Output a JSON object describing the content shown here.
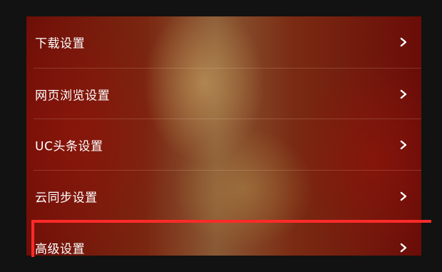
{
  "settings_list": {
    "items": [
      {
        "label": "下载设置"
      },
      {
        "label": "网页浏览设置"
      },
      {
        "label": "UC头条设置"
      },
      {
        "label": "云同步设置"
      },
      {
        "label": "高级设置"
      }
    ]
  },
  "icons": {
    "chevron": "chevron-right-icon"
  },
  "colors": {
    "highlight_border": "#ff2a2a",
    "label_text": "#ffffff",
    "page_background": "#121212"
  }
}
